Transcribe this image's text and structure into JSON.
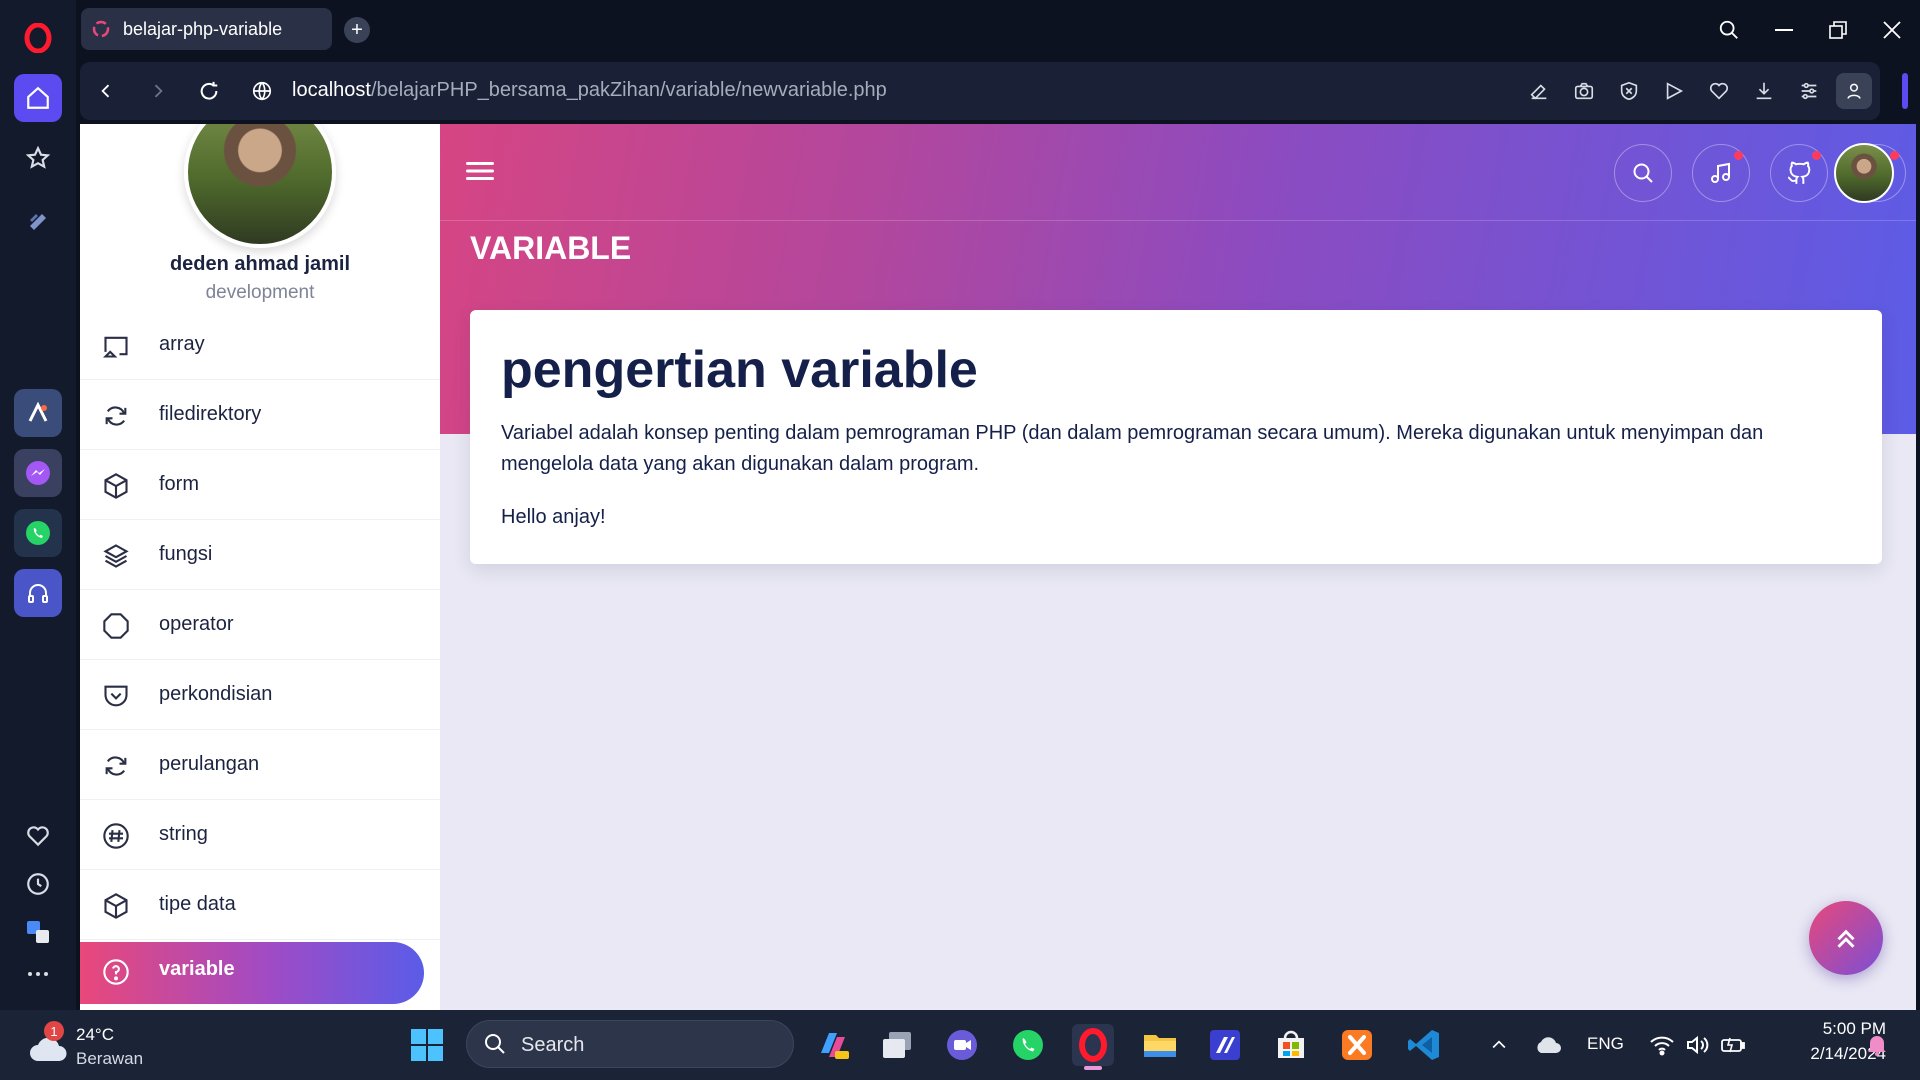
{
  "browser": {
    "tab_title": "belajar-php-variable",
    "url_host": "localhost",
    "url_path": "/belajarPHP_bersama_pakZihan/variable/newvariable.php"
  },
  "profile": {
    "name": "deden ahmad jamil",
    "role": "development"
  },
  "sidebar": {
    "items": [
      {
        "label": "array",
        "icon": "cast-icon"
      },
      {
        "label": "filedirektory",
        "icon": "refresh-icon"
      },
      {
        "label": "form",
        "icon": "box-icon"
      },
      {
        "label": "fungsi",
        "icon": "layers-icon"
      },
      {
        "label": "operator",
        "icon": "octagon-icon"
      },
      {
        "label": "perkondisian",
        "icon": "pocket-icon"
      },
      {
        "label": "perulangan",
        "icon": "refresh-icon"
      },
      {
        "label": "string",
        "icon": "hash-icon"
      },
      {
        "label": "tipe data",
        "icon": "box-icon"
      },
      {
        "label": "variable",
        "icon": "help-circle-icon",
        "active": true
      }
    ]
  },
  "header": {
    "page_title": "VARIABLE"
  },
  "content": {
    "heading": "pengertian variable",
    "description": "Variabel adalah konsep penting dalam pemrograman PHP (dan dalam pemrograman secara umum). Mereka digunakan untuk menyimpan dan mengelola data yang akan digunakan dalam program.",
    "output": "Hello anjay!"
  },
  "taskbar": {
    "weather_badge": "1",
    "temperature": "24°C",
    "weather": "Berawan",
    "search_label": "Search",
    "language": "ENG",
    "time": "5:00 PM",
    "date": "2/14/2024"
  },
  "colors": {
    "accent_pink": "#e9487a",
    "accent_blue": "#5a5ce8",
    "page_bg": "#e9e8f4"
  }
}
